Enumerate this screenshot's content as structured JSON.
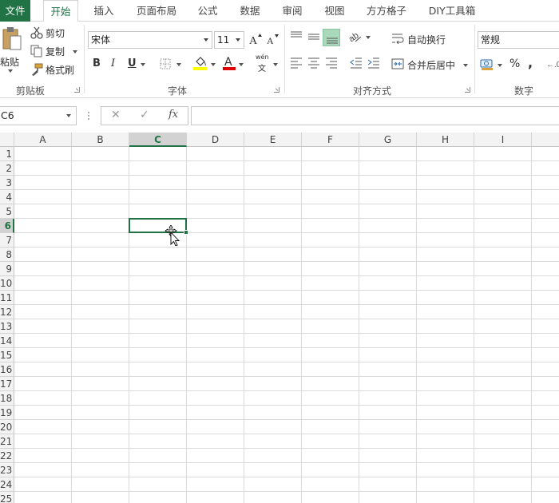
{
  "tabs": [
    "文件",
    "开始",
    "插入",
    "页面布局",
    "公式",
    "数据",
    "审阅",
    "视图",
    "方方格子",
    "DIY工具箱"
  ],
  "clipboard": {
    "paste_label": "粘贴",
    "cut_label": "剪切",
    "copy_label": "复制",
    "format_painter_label": "格式刷",
    "group_label": "剪贴板"
  },
  "font": {
    "font_name": "宋体",
    "font_size": "11",
    "bold": "B",
    "italic": "I",
    "underline": "U",
    "font_color_glyph": "A",
    "phonetic_top": "wén",
    "phonetic_bottom": "文",
    "group_label": "字体"
  },
  "alignment": {
    "wrap_text_label": "自动换行",
    "merge_center_label": "合并后居中",
    "group_label": "对齐方式"
  },
  "number": {
    "format_value": "常规",
    "percent": "%",
    "comma": ",",
    "group_label": "数字"
  },
  "formula_bar": {
    "name_box": "C6",
    "fx_label": "fx",
    "cancel_glyph": "✕",
    "enter_glyph": "✓",
    "formula": ""
  },
  "sheet": {
    "columns": [
      "A",
      "B",
      "C",
      "D",
      "E",
      "F",
      "G",
      "H",
      "I"
    ],
    "rows": [
      "1",
      "2",
      "3",
      "4",
      "5",
      "6",
      "7",
      "8",
      "9",
      "10",
      "11",
      "12",
      "13",
      "14",
      "15",
      "16",
      "17",
      "18",
      "19",
      "20",
      "21",
      "22",
      "23",
      "24",
      "25"
    ],
    "selected_column": "C",
    "selected_row": "6"
  },
  "colors": {
    "accent": "#217346",
    "highlight_yellow": "#ffff00",
    "font_red": "#e00000"
  }
}
